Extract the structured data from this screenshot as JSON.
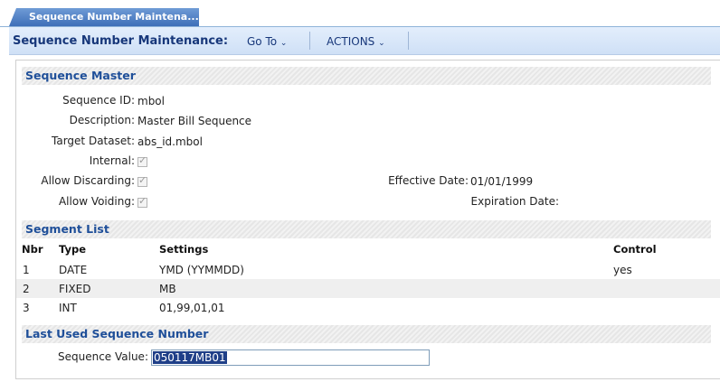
{
  "tab": {
    "label": "Sequence Number Maintena..."
  },
  "toolbar": {
    "title": "Sequence Number Maintenance:",
    "goto": "Go To",
    "actions": "ACTIONS"
  },
  "sequence_master": {
    "heading": "Sequence Master",
    "sequence_id_label": "Sequence ID:",
    "sequence_id": "mbol",
    "description_label": "Description:",
    "description": "Master Bill Sequence",
    "target_dataset_label": "Target Dataset:",
    "target_dataset": "abs_id.mbol",
    "internal_label": "Internal:",
    "internal": true,
    "allow_discarding_label": "Allow Discarding:",
    "allow_discarding": true,
    "allow_voiding_label": "Allow Voiding:",
    "allow_voiding": true,
    "effective_date_label": "Effective Date:",
    "effective_date": "01/01/1999",
    "expiration_date_label": "Expiration Date:",
    "expiration_date": ""
  },
  "segment_list": {
    "heading": "Segment List",
    "columns": [
      "Nbr",
      "Type",
      "Settings",
      "Control"
    ],
    "rows": [
      {
        "nbr": "1",
        "type": "DATE",
        "settings": "YMD (YYMMDD)",
        "control": "yes"
      },
      {
        "nbr": "2",
        "type": "FIXED",
        "settings": "MB",
        "control": ""
      },
      {
        "nbr": "3",
        "type": "INT",
        "settings": "01,99,01,01",
        "control": ""
      }
    ]
  },
  "last_used": {
    "heading": "Last Used Sequence Number",
    "sequence_value_label": "Sequence Value:",
    "sequence_value": "050117MB01"
  },
  "colors": {
    "accent": "#1f4f99",
    "tab": "#3e6fb8",
    "toolbar_bg": "#d9e7fa"
  }
}
